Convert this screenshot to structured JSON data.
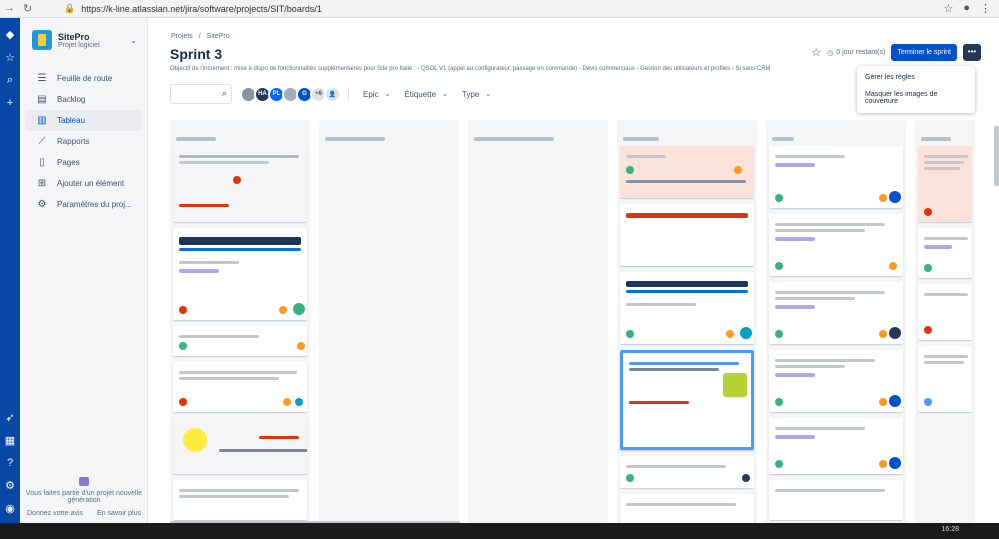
{
  "browser": {
    "url": "https://k-line.atlassian.net/jira/software/projects/SIT/boards/1"
  },
  "sidebar": {
    "project_name": "SitePro",
    "project_type": "Projet logiciel",
    "items": [
      {
        "label": "Feuille de route",
        "icon": "roadmap-icon"
      },
      {
        "label": "Backlog",
        "icon": "backlog-icon"
      },
      {
        "label": "Tableau",
        "icon": "board-icon"
      },
      {
        "label": "Rapports",
        "icon": "reports-icon"
      },
      {
        "label": "Pages",
        "icon": "pages-icon"
      },
      {
        "label": "Ajouter un élément",
        "icon": "add-item-icon"
      },
      {
        "label": "Paramètres du proj...",
        "icon": "settings-icon"
      }
    ],
    "footer_text": "Vous faites partie d'un projet nouvelle génération",
    "footer_feedback": "Donnez votre avis",
    "footer_more": "En savoir plus"
  },
  "header": {
    "breadcrumb_projects": "Projets",
    "breadcrumb_sep": "/",
    "breadcrumb_project": "SitePro",
    "title": "Sprint 3",
    "goal": "Objectif de l'incrément : mise à dispo de fonctionnalités supplémentaires pour Site pro Italie : - QSOL V1 (appel au configurateur, passage en commande) - Devis commerciaux - Gestion des utilisateurs et profiles - Si sans CRM",
    "remaining": "0 jour restant(s)",
    "finish_button": "Terminer le sprint",
    "more_button": "•••"
  },
  "menu": {
    "manage_rules": "Gérer les règles",
    "hide_covers": "Masquer les images de couverture"
  },
  "filters": {
    "avatars": [
      {
        "initials": "",
        "color": "#8993a4"
      },
      {
        "initials": "HA",
        "color": "#253858"
      },
      {
        "initials": "PL",
        "color": "#0065ff"
      },
      {
        "initials": "",
        "color": "#a5adba"
      },
      {
        "initials": "G",
        "color": "#0052cc"
      },
      {
        "initials": "+6",
        "color": "#dfe1e6"
      }
    ],
    "epic": "Epic",
    "label": "Étiquette",
    "type": "Type"
  },
  "taskbar": {
    "clock": "16:28"
  }
}
